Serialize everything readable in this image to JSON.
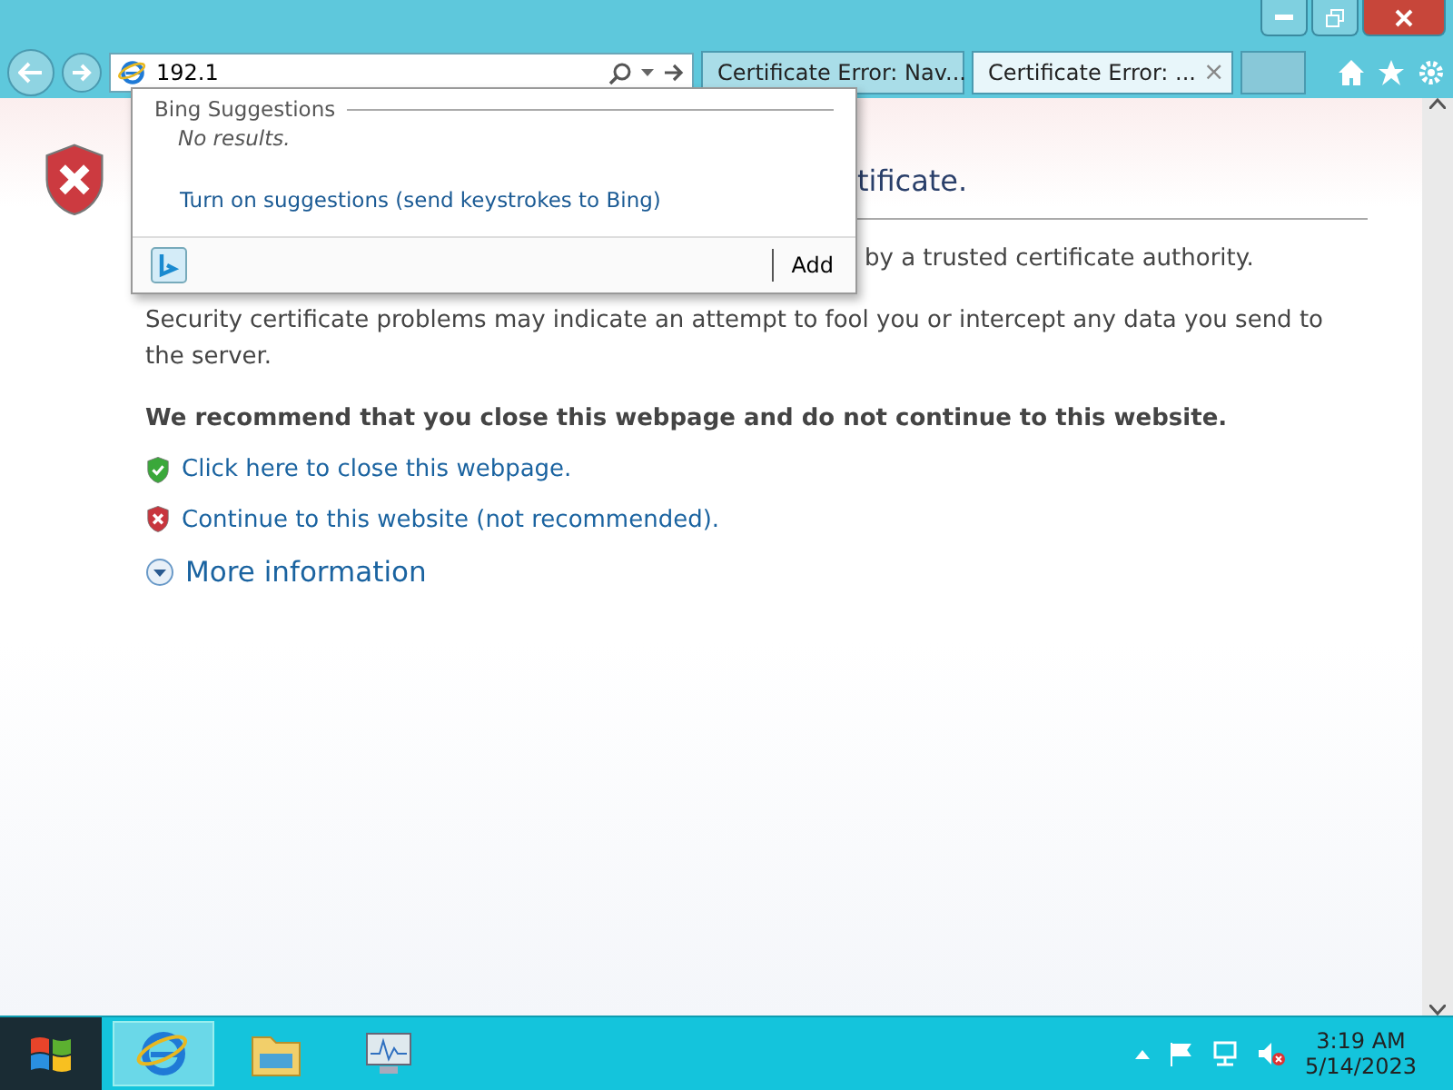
{
  "address_bar": {
    "value": "192.1"
  },
  "tabs": [
    {
      "label": "Certificate Error: Nav...",
      "selected": false,
      "closable": false
    },
    {
      "label": "Certificate Error: ...",
      "selected": true,
      "closable": true
    }
  ],
  "close_glyph": "×",
  "suggestions": {
    "header": "Bing Suggestions",
    "empty_text": "No results.",
    "link": "Turn on suggestions (send keystrokes to Bing)",
    "add_button": "Add"
  },
  "page": {
    "heading_visible": "tificate.",
    "line_visible": "by a trusted certificate authority.",
    "paragraph": "Security certificate problems may indicate an attempt to fool you or intercept any data you send to the server.",
    "recommendation": "We recommend that you close this webpage and do not continue to this website.",
    "links": [
      {
        "kind": "safe",
        "label": "Click here to close this webpage."
      },
      {
        "kind": "danger",
        "label": "Continue to this website (not recommended)."
      }
    ],
    "more_info": "More information"
  },
  "taskbar": {
    "apps": [
      {
        "kind": "browser",
        "selected": true
      },
      {
        "kind": "folder",
        "selected": false
      },
      {
        "kind": "monitor",
        "selected": false
      }
    ],
    "time": "3:19 AM",
    "date": "5/14/2023"
  }
}
